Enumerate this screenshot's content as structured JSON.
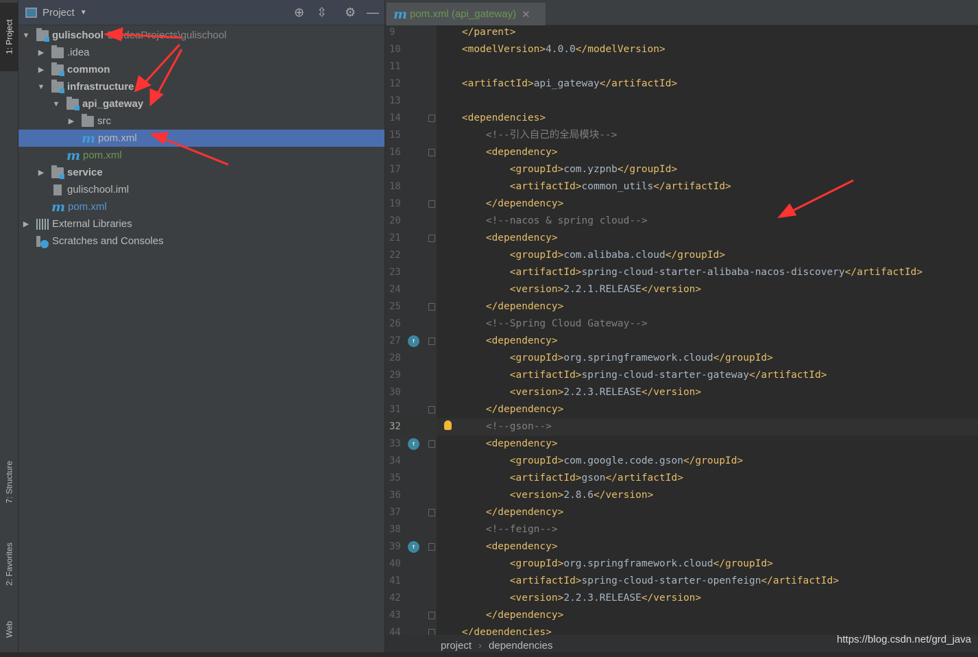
{
  "sidebar_tabs": [
    "1: Project",
    "7: Structure",
    "2: Favorites",
    "Web"
  ],
  "project_panel": {
    "title": "Project",
    "tools": [
      "locate-icon",
      "collapse-icon",
      "gear-icon",
      "minimize-icon"
    ],
    "tree": [
      {
        "label": "gulischool",
        "path": "D:\\IdeaProjects\\gulischool",
        "arrow": "▼",
        "icon": "module",
        "depth": 0,
        "style": "bold"
      },
      {
        "label": ".idea",
        "arrow": "▶",
        "icon": "folder",
        "depth": 1
      },
      {
        "label": "common",
        "arrow": "▶",
        "icon": "module",
        "depth": 1,
        "style": "bold"
      },
      {
        "label": "infrastructure",
        "arrow": "▼",
        "icon": "module",
        "depth": 1,
        "style": "bold"
      },
      {
        "label": "api_gateway",
        "arrow": "▼",
        "icon": "module",
        "depth": 2,
        "style": "bold"
      },
      {
        "label": "src",
        "arrow": "▶",
        "icon": "folder",
        "depth": 3
      },
      {
        "label": "pom.xml",
        "arrow": "",
        "icon": "maven",
        "depth": 3,
        "selected": true
      },
      {
        "label": "pom.xml",
        "arrow": "",
        "icon": "maven",
        "depth": 2,
        "style": "green"
      },
      {
        "label": "service",
        "arrow": "▶",
        "icon": "module",
        "depth": 1,
        "style": "bold"
      },
      {
        "label": "gulischool.iml",
        "arrow": "",
        "icon": "iml",
        "depth": 1
      },
      {
        "label": "pom.xml",
        "arrow": "",
        "icon": "maven",
        "depth": 1,
        "style": "blue"
      },
      {
        "label": "External Libraries",
        "arrow": "▶",
        "icon": "libraries",
        "depth": 0
      },
      {
        "label": "Scratches and Consoles",
        "arrow": "",
        "icon": "scratches",
        "depth": 0
      }
    ]
  },
  "editor": {
    "tab_label": "pom.xml (api_gateway)",
    "current_line": 32,
    "lines": [
      {
        "n": 9,
        "code": "    </parent>"
      },
      {
        "n": 10,
        "code": "    <modelVersion>4.0.0</modelVersion>"
      },
      {
        "n": 11,
        "code": ""
      },
      {
        "n": 12,
        "code": "    <artifactId>api_gateway</artifactId>"
      },
      {
        "n": 13,
        "code": ""
      },
      {
        "n": 14,
        "code": "    <dependencies>",
        "fold": true
      },
      {
        "n": 15,
        "code": "        <!--引入自己的全局模块-->"
      },
      {
        "n": 16,
        "code": "        <dependency>",
        "fold": true
      },
      {
        "n": 17,
        "code": "            <groupId>com.yzpnb</groupId>"
      },
      {
        "n": 18,
        "code": "            <artifactId>common_utils</artifactId>"
      },
      {
        "n": 19,
        "code": "        </dependency>",
        "fold": true
      },
      {
        "n": 20,
        "code": "        <!--nacos & spring cloud-->"
      },
      {
        "n": 21,
        "code": "        <dependency>",
        "fold": true
      },
      {
        "n": 22,
        "code": "            <groupId>com.alibaba.cloud</groupId>"
      },
      {
        "n": 23,
        "code": "            <artifactId>spring-cloud-starter-alibaba-nacos-discovery</artifactId>"
      },
      {
        "n": 24,
        "code": "            <version>2.2.1.RELEASE</version>"
      },
      {
        "n": 25,
        "code": "        </dependency>",
        "fold": true
      },
      {
        "n": 26,
        "code": "        <!--Spring Cloud Gateway-->"
      },
      {
        "n": 27,
        "code": "        <dependency>",
        "fold": true,
        "gicon": true
      },
      {
        "n": 28,
        "code": "            <groupId>org.springframework.cloud</groupId>"
      },
      {
        "n": 29,
        "code": "            <artifactId>spring-cloud-starter-gateway</artifactId>"
      },
      {
        "n": 30,
        "code": "            <version>2.2.3.RELEASE</version>"
      },
      {
        "n": 31,
        "code": "        </dependency>",
        "fold": true
      },
      {
        "n": 32,
        "code": "        <!--gson-->",
        "bulb": true
      },
      {
        "n": 33,
        "code": "        <dependency>",
        "fold": true,
        "gicon": true
      },
      {
        "n": 34,
        "code": "            <groupId>com.google.code.gson</groupId>"
      },
      {
        "n": 35,
        "code": "            <artifactId>gson</artifactId>"
      },
      {
        "n": 36,
        "code": "            <version>2.8.6</version>"
      },
      {
        "n": 37,
        "code": "        </dependency>",
        "fold": true
      },
      {
        "n": 38,
        "code": "        <!--feign-->"
      },
      {
        "n": 39,
        "code": "        <dependency>",
        "fold": true,
        "gicon": true
      },
      {
        "n": 40,
        "code": "            <groupId>org.springframework.cloud</groupId>"
      },
      {
        "n": 41,
        "code": "            <artifactId>spring-cloud-starter-openfeign</artifactId>"
      },
      {
        "n": 42,
        "code": "            <version>2.2.3.RELEASE</version>"
      },
      {
        "n": 43,
        "code": "        </dependency>",
        "fold": true
      },
      {
        "n": 44,
        "code": "    </dependencies>",
        "fold": true
      }
    ],
    "breadcrumbs": [
      "project",
      "dependencies"
    ]
  },
  "watermark": "https://blog.csdn.net/grd_java",
  "colors": {
    "tag": "#e8bf6a",
    "text": "#a9b7c6",
    "comment": "#808080",
    "selection": "#4b6eaf",
    "annotation_arrow": "#ff3333"
  }
}
